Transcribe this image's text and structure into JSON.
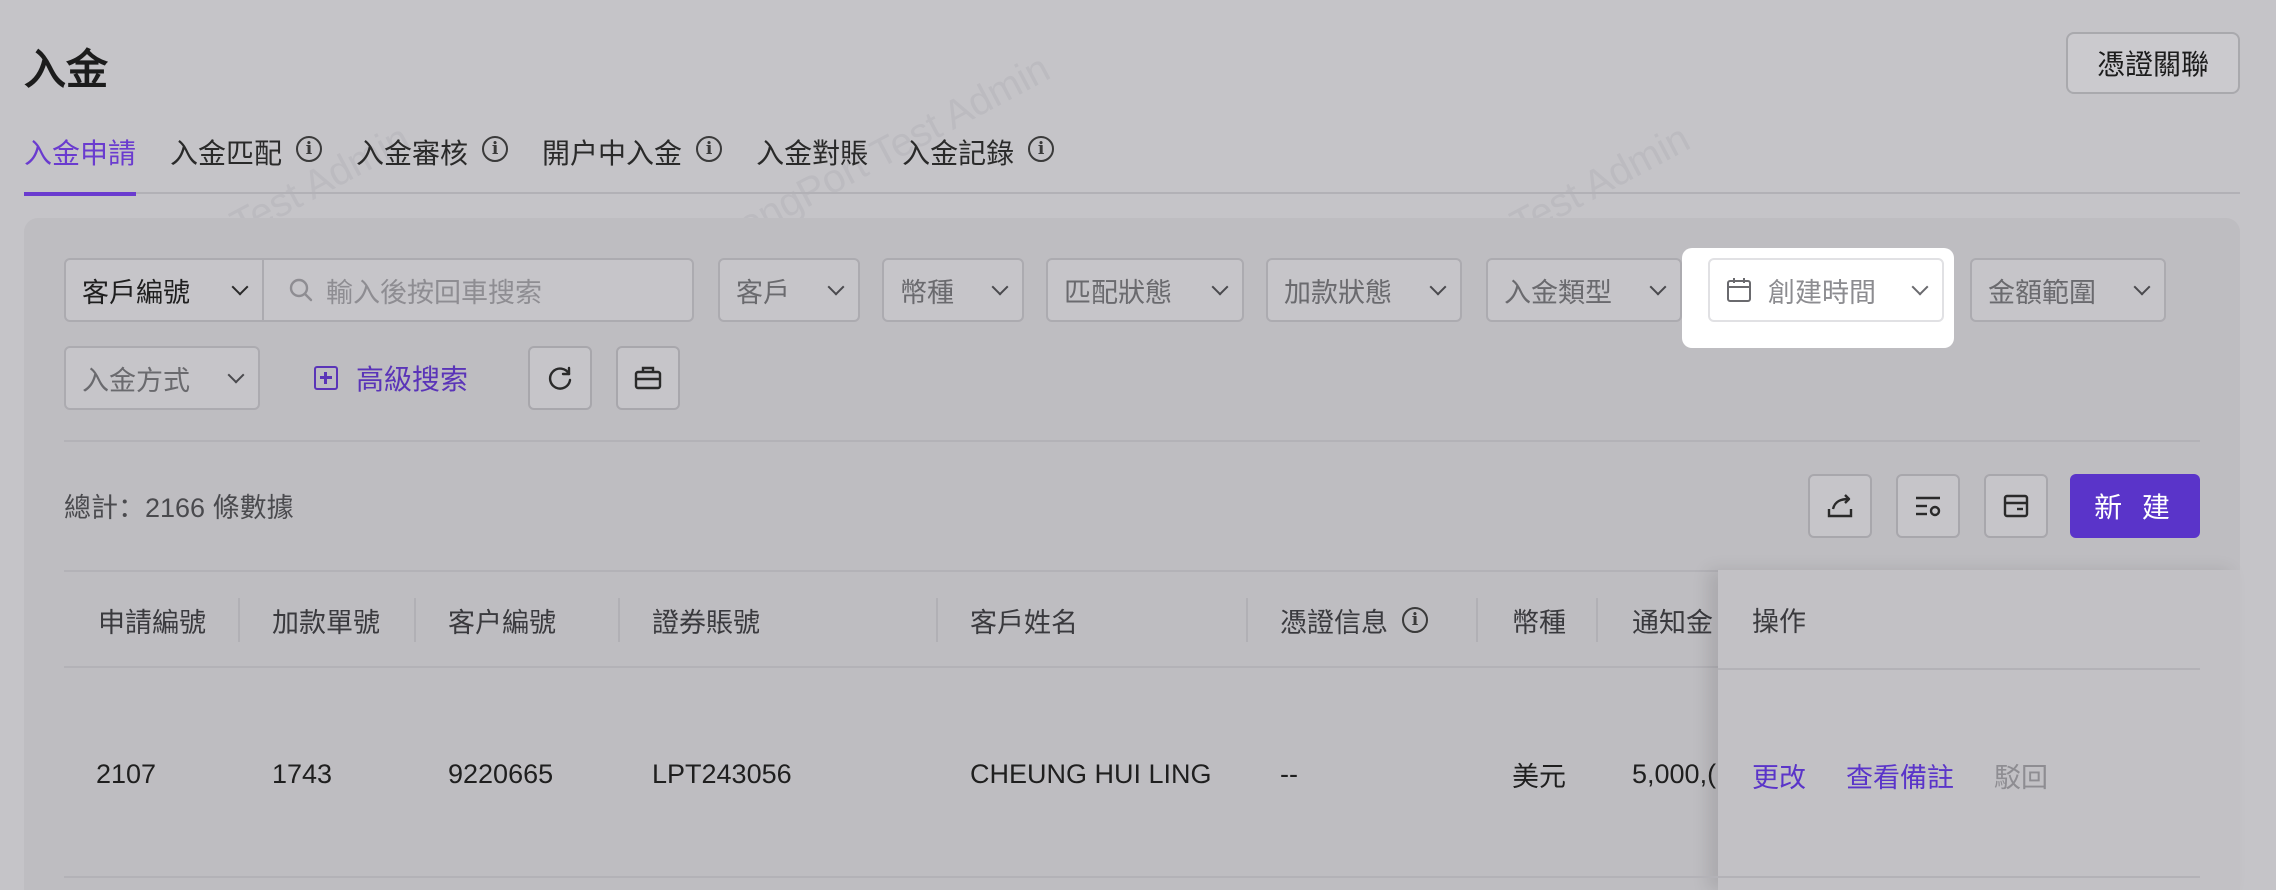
{
  "page": {
    "title": "入金",
    "top_button": "憑證關聯"
  },
  "tabs": [
    {
      "label": "入金申請",
      "active": true,
      "info": false
    },
    {
      "label": "入金匹配",
      "active": false,
      "info": true
    },
    {
      "label": "入金審核",
      "active": false,
      "info": true
    },
    {
      "label": "開户中入金",
      "active": false,
      "info": true
    },
    {
      "label": "入金對賬",
      "active": false,
      "info": false
    },
    {
      "label": "入金記錄",
      "active": false,
      "info": true
    }
  ],
  "filters": {
    "search_field": "客戶編號",
    "search_placeholder": "輸入後按回車搜索",
    "customer": "客戶",
    "currency": "幣種",
    "match_status": "匹配狀態",
    "funding_status": "加款狀態",
    "deposit_type": "入金類型",
    "created_time": "創建時間",
    "amount_range": "金額範圍",
    "deposit_method": "入金方式",
    "advanced_search": "高級搜索"
  },
  "summary": {
    "total": "總計：2166 條數據",
    "new_button": "新 建"
  },
  "table": {
    "columns": [
      "申請編號",
      "加款單號",
      "客户編號",
      "證券賬號",
      "客戶姓名",
      "憑證信息",
      "幣種",
      "通知金"
    ],
    "operations_header": "操作",
    "rows": [
      {
        "id": "2107",
        "funding_no": "1743",
        "customer_no": "9220665",
        "account": "LPT243056",
        "name": "CHEUNG HUI LING",
        "voucher": "--",
        "currency": "美元",
        "amount": "5,000,("
      }
    ],
    "actions": [
      "更改",
      "查看備註",
      "駁回"
    ]
  },
  "watermark": "LongPort Test Admin",
  "colors": {
    "accent": "#5a34c9",
    "tab_active": "#6a3bcf",
    "disabled": "#8e8d92"
  }
}
